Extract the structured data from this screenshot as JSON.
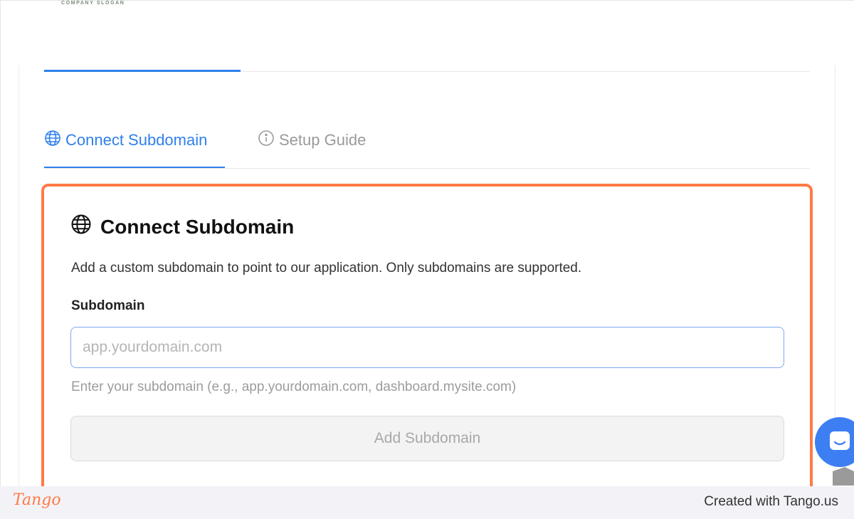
{
  "header": {
    "slogan": "COMPANY SLOGAN"
  },
  "tabs": [
    {
      "label": "Connect Subdomain",
      "icon": "globe-icon",
      "active": true
    },
    {
      "label": "Setup Guide",
      "icon": "info-icon",
      "active": false
    }
  ],
  "section": {
    "title": "Connect Subdomain",
    "description": "Add a custom subdomain to point to our application. Only subdomains are supported.",
    "field_label": "Subdomain",
    "input_value": "",
    "input_placeholder": "app.yourdomain.com",
    "hint": "Enter your subdomain (e.g., app.yourdomain.com, dashboard.mysite.com)",
    "submit_label": "Add Subdomain"
  },
  "footer": {
    "brand": "Tango",
    "created_with": "Created with Tango.us"
  },
  "colors": {
    "accent": "#2f80ed",
    "highlight": "#ff7a45",
    "chat": "#3d7ff2"
  }
}
